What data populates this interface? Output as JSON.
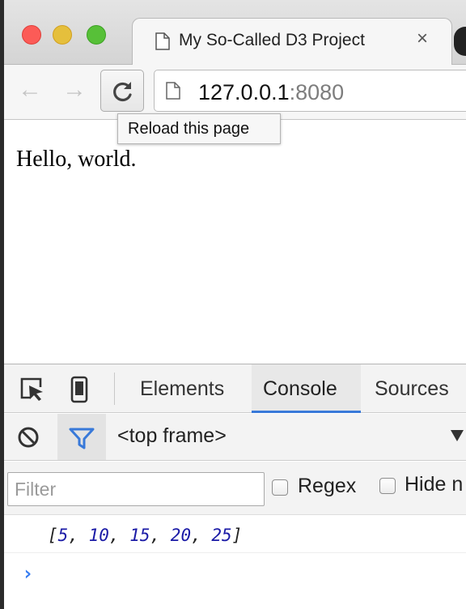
{
  "browser": {
    "tab": {
      "title": "My So-Called D3 Project",
      "close_glyph": "×"
    },
    "nav": {
      "back_glyph": "←",
      "forward_glyph": "→"
    },
    "address": {
      "host": "127.0.0.1",
      "port": ":8080"
    },
    "tooltip": "Reload this page"
  },
  "page": {
    "body_text": "Hello, world."
  },
  "devtools": {
    "tabs": {
      "elements": "Elements",
      "console": "Console",
      "sources": "Sources"
    },
    "context": {
      "frame": "<top frame>"
    },
    "filter": {
      "placeholder": "Filter",
      "regex_label": "Regex",
      "hide_label": "Hide n"
    },
    "console": {
      "open_bracket": "[",
      "close_bracket": "]",
      "separator": ", ",
      "values": [
        "5",
        "10",
        "15",
        "20",
        "25"
      ],
      "prompt": "›"
    }
  },
  "colors": {
    "accent": "#3879d9",
    "number": "#1a1aa6",
    "prompt": "#367cf1"
  }
}
